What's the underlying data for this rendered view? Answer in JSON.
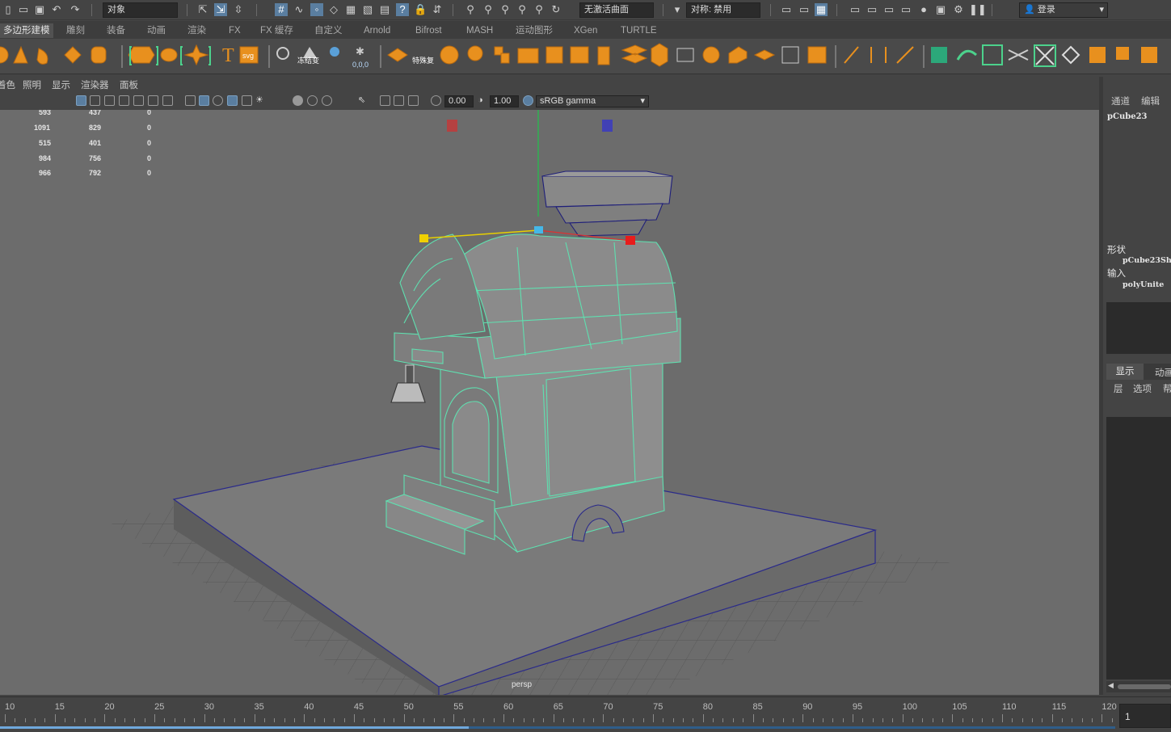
{
  "status_line": {
    "mode_menu": "对象",
    "curve_field": "无激活曲面",
    "symmetry": "对称: 禁用",
    "login": "登录"
  },
  "shelf_tabs": [
    "多边形建模",
    "雕刻",
    "装备",
    "动画",
    "渲染",
    "FX",
    "FX 缓存",
    "自定义",
    "Arnold",
    "Bifrost",
    "MASH",
    "运动图形",
    "XGen",
    "TURTLE"
  ],
  "shelf_icon_labels": {
    "freeze": "冻结变",
    "special": "特殊复"
  },
  "panel_menu": [
    "着色",
    "照明",
    "显示",
    "渲染器",
    "面板"
  ],
  "panel_toolbar": {
    "exposure": "0.00",
    "gamma": "1.00",
    "color_space": "sRGB gamma"
  },
  "hud_rows": [
    [
      "593",
      "437",
      "0"
    ],
    [
      "1091",
      "829",
      "0"
    ],
    [
      "515",
      "401",
      "0"
    ],
    [
      "984",
      "756",
      "0"
    ],
    [
      "966",
      "792",
      "0"
    ]
  ],
  "camera_label": "persp",
  "channel_box": {
    "tab_channels": "通道",
    "tab_edit": "编辑",
    "object_name": "pCube23",
    "shapes_label": "形状",
    "shape_name": "pCube23Sh",
    "inputs_label": "输入",
    "input_name": "polyUnite",
    "layer_tab_display": "显示",
    "layer_tab_anim": "动画",
    "layer_menu_layers": "层",
    "layer_menu_options": "选项",
    "layer_menu_help": "帮"
  },
  "timeline": {
    "ticks": [
      "10",
      "15",
      "20",
      "25",
      "30",
      "35",
      "40",
      "45",
      "50",
      "55",
      "60",
      "65",
      "70",
      "75",
      "80",
      "85",
      "90",
      "95",
      "100",
      "105",
      "110",
      "115",
      "120"
    ],
    "current_frame": "1",
    "playback_fraction": 0.42
  },
  "colors": {
    "accent": "#5a7ea0",
    "wire_select": "#5fe0b0",
    "shelf_orange": "#e8901e",
    "viewport_bg": "#6c6c6c"
  }
}
